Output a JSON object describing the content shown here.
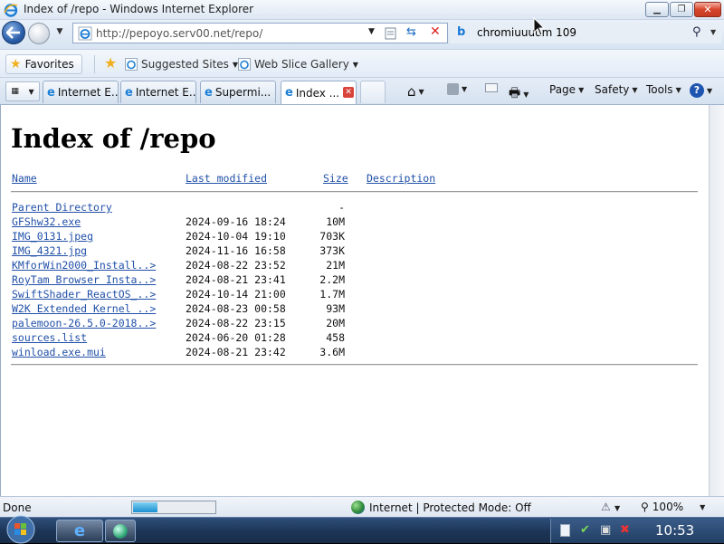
{
  "window": {
    "title": "Index of /repo - Windows Internet Explorer"
  },
  "nav": {
    "url": "http://pepoyo.serv00.net/repo/",
    "search_value": "chromiuuuum 109"
  },
  "favorites_bar": {
    "favorites_label": "Favorites",
    "items": [
      {
        "label": "Suggested Sites"
      },
      {
        "label": "Web Slice Gallery"
      }
    ]
  },
  "tabs": [
    {
      "label": "Internet E..."
    },
    {
      "label": "Internet E..."
    },
    {
      "label": "Supermi..."
    },
    {
      "label": "Index ...",
      "active": true
    }
  ],
  "command_bar": {
    "page": "Page",
    "safety": "Safety",
    "tools": "Tools"
  },
  "page": {
    "heading": "Index of /repo",
    "columns": {
      "name": "Name",
      "modified": "Last modified",
      "size": "Size",
      "description": "Description"
    },
    "parent": {
      "name": "Parent Directory",
      "size": "-"
    },
    "rows": [
      {
        "name": "GFShw32.exe",
        "modified": "2024-09-16 18:24",
        "size": "10M"
      },
      {
        "name": "IMG_0131.jpeg",
        "modified": "2024-10-04 19:10",
        "size": "703K"
      },
      {
        "name": "IMG_4321.jpg",
        "modified": "2024-11-16 16:58",
        "size": "373K"
      },
      {
        "name": "KMforWin2000_Install..>",
        "modified": "2024-08-22 23:52",
        "size": "21M"
      },
      {
        "name": "RoyTam Browser Insta..>",
        "modified": "2024-08-21 23:41",
        "size": "2.2M"
      },
      {
        "name": "SwiftShader_ReactOS_..>",
        "modified": "2024-10-14 21:00",
        "size": "1.7M"
      },
      {
        "name": "W2K Extended Kernel ..>",
        "modified": "2024-08-23 00:58",
        "size": "93M"
      },
      {
        "name": "palemoon-26.5.0-2018..>",
        "modified": "2024-08-22 23:15",
        "size": "20M"
      },
      {
        "name": "sources.list",
        "modified": "2024-06-20 01:28",
        "size": "458"
      },
      {
        "name": "winload.exe.mui",
        "modified": "2024-08-21 23:42",
        "size": "3.6M"
      }
    ]
  },
  "status": {
    "text": "Done",
    "progress": 0.3,
    "zone": "Internet | Protected Mode: Off",
    "zoom": "100%"
  },
  "taskbar": {
    "clock": "10:53"
  },
  "colors": {
    "link": "#2150a8",
    "taskbar": "#1c3556",
    "close_button": "#d7452b"
  }
}
